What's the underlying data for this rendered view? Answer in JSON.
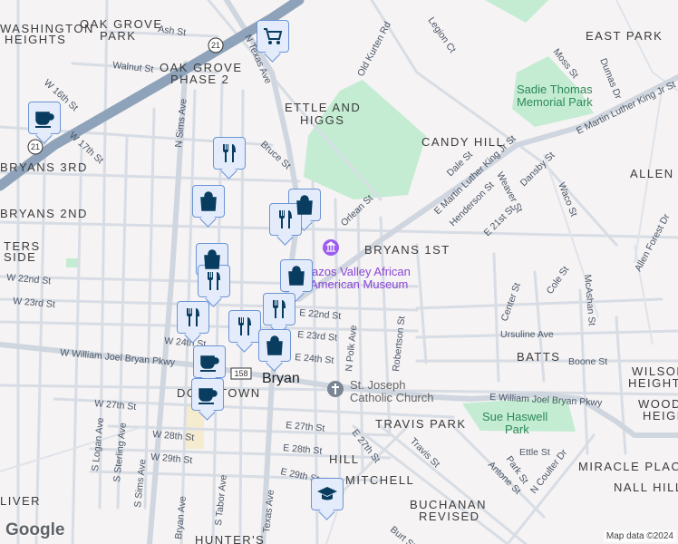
{
  "neighborhoods": [
    "WASHINGTON",
    "HEIGHTS",
    "OAK GROVE",
    "PARK",
    "OAK GROVE",
    "PHASE 2",
    "ETTLE AND",
    "HIGGS",
    "CANDY HILL",
    "EAST PARK",
    "ALLEN F",
    "BRYANS 3RD",
    "BRYANS 2ND",
    "BRYANS 1ST",
    "TERS",
    "SIDE",
    "BATTS",
    "WILSON",
    "HEIGHTS",
    "WOOD",
    "HEIGHTS",
    "TRAVIS PARK",
    "MIRACLE PLACE",
    "NALL HILL",
    "HILL",
    "MITCHELL",
    "BUCHANAN",
    "REVISED",
    "LIVER",
    "DOWNTOWN",
    "HUNTER'S"
  ],
  "streets": [
    "Ash St",
    "Walnut St",
    "W 16th St",
    "W 17th St",
    "N Sims Ave",
    "N Texas Ave",
    "Bruce St",
    "Old Kurten Rd",
    "Legion Ct",
    "Moss St",
    "Dumas Dr",
    "E Martin Luther King Jr St",
    "E Martin Luther King Jr St",
    "Dale St",
    "Orlean St",
    "Henderson St",
    "Weaver St",
    "Dansby St",
    "E 21st St",
    "Waco St",
    "Allen Forest Dr",
    "W 22nd St",
    "W 23rd St",
    "W 24th St",
    "W William Joel Bryan Pkwy",
    "W 27th St",
    "W 28th St",
    "W 29th St",
    "S Logan Ave",
    "S Sterling Ave",
    "S Sims Ave",
    "Bryan Ave",
    "S Tabor Ave",
    "Texas Ave",
    "E 22nd St",
    "E 23rd St",
    "E 24th St",
    "E 27th St",
    "E 28th St",
    "E 29th St",
    "N Polk Ave",
    "Robertson St",
    "Center St",
    "Cole St",
    "McAshan St",
    "Ursuline Ave",
    "Boone St",
    "E William Joel Bryan Pkwy",
    "E 27th St",
    "Travis St",
    "Ettle St",
    "Park St",
    "Antone St",
    "N Coulter Dr",
    "Burt St"
  ],
  "parks": [
    "Sadie Thomas",
    "Memorial Park",
    "Sue Haswell",
    "Park"
  ],
  "poi": {
    "museum_line1": "Brazos Valley African",
    "museum_line2": "American Museum",
    "church_line1": "St. Joseph",
    "church_line2": "Catholic Church"
  },
  "city": "Bryan",
  "shields": [
    "21",
    "21",
    "158"
  ],
  "markers": [
    "shopping-cart",
    "coffee",
    "restaurant",
    "shopping-bag",
    "shopping-bag",
    "restaurant",
    "shopping-bag",
    "restaurant",
    "shopping-bag",
    "restaurant",
    "restaurant",
    "restaurant",
    "shopping-bag",
    "coffee",
    "coffee",
    "graduation-cap"
  ],
  "footer": {
    "logo": "Google",
    "attribution": "Map data ©2024"
  }
}
